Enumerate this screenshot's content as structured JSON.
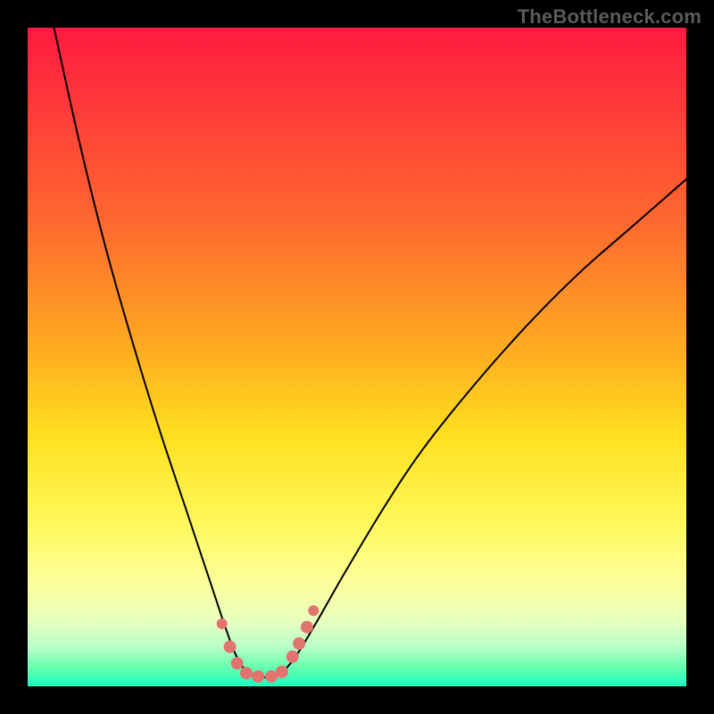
{
  "watermark": "TheBottleneck.com",
  "colors": {
    "frame_bg": "#000000",
    "curve_stroke": "#000000",
    "marker_fill": "#e2736f",
    "gradient_top": "#ff1a40",
    "gradient_bottom": "#1affc0"
  },
  "chart_data": {
    "type": "line",
    "title": "",
    "xlabel": "",
    "ylabel": "",
    "xlim": [
      0,
      100
    ],
    "ylim": [
      0,
      100
    ],
    "series": [
      {
        "name": "bottleneck-curve",
        "x": [
          4,
          8,
          12,
          16,
          20,
          24,
          26,
          28,
          30,
          31.5,
          33,
          35,
          37,
          39,
          41,
          44,
          48,
          54,
          60,
          68,
          76,
          84,
          92,
          100
        ],
        "y": [
          100,
          82,
          66,
          52,
          39,
          27,
          21,
          15,
          9,
          5,
          2.5,
          1.5,
          1.5,
          2.5,
          5,
          10,
          17,
          27,
          36,
          46,
          55,
          63,
          70,
          77
        ]
      }
    ],
    "markers": {
      "name": "highlight-dots",
      "x": [
        29.5,
        30.7,
        31.8,
        33.2,
        35.0,
        37.0,
        38.6,
        40.2,
        41.2,
        42.4,
        43.4
      ],
      "y": [
        9.5,
        6.0,
        3.5,
        2.0,
        1.5,
        1.5,
        2.2,
        4.5,
        6.5,
        9.0,
        11.5
      ],
      "r": [
        6,
        7,
        7,
        7,
        7,
        7,
        7,
        7,
        7,
        7,
        6
      ]
    },
    "grid": false,
    "legend": false
  }
}
